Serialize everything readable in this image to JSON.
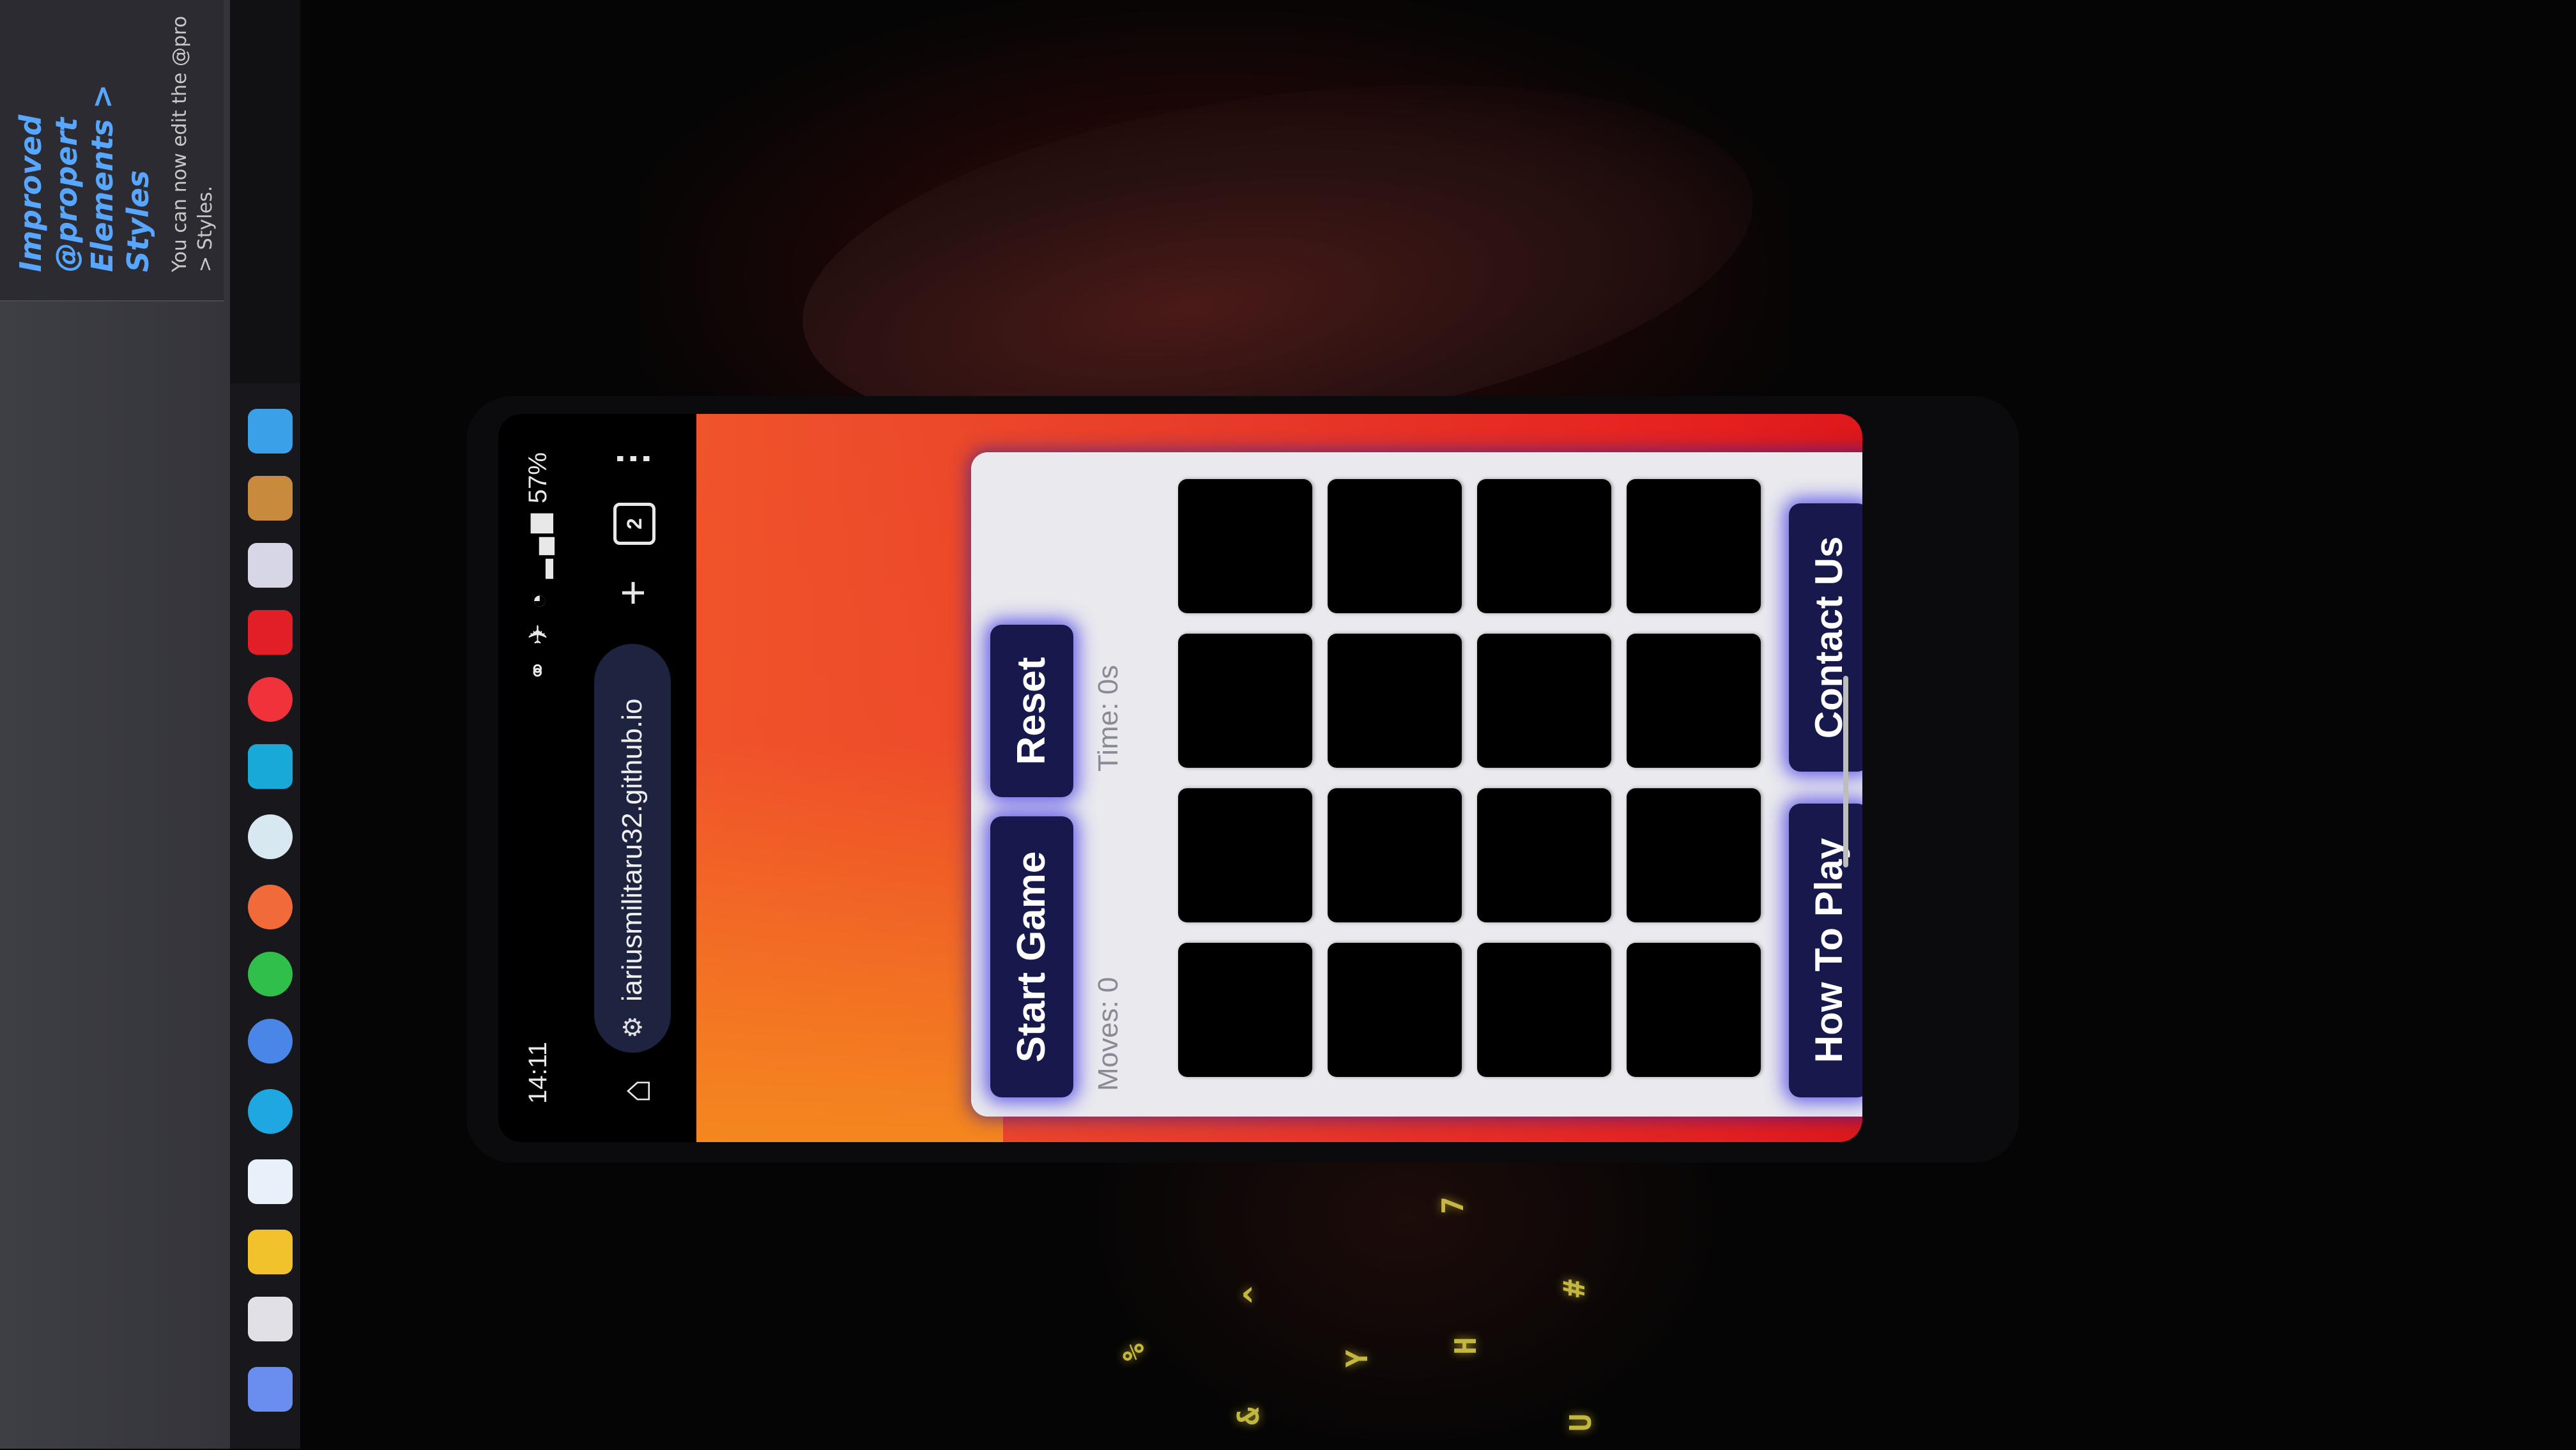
{
  "monitor": {
    "note_title": "Improved @propert Elements > Styles",
    "note_body": "You can now edit the @pro > Styles."
  },
  "phone": {
    "status": {
      "time": "14:11",
      "battery": "57%"
    },
    "browser": {
      "url": "iariusmilitaru32.github.io",
      "tab_count": "2"
    },
    "game": {
      "start_label": "Start Game",
      "reset_label": "Reset",
      "moves_text": "Moves: 0",
      "time_text": "Time: 0s",
      "how_to_play_label": "How To Play",
      "contact_label": "Contact Us",
      "grid_rows": 4,
      "grid_cols": 4
    }
  },
  "colors": {
    "button_bg": "#17194c",
    "button_glow": "#3c32e6",
    "card_bg": "#e9e9ee",
    "gradient_top": "#f58a1e",
    "gradient_bottom": "#d30d14",
    "url_pill": "#1e2340"
  },
  "icons": [
    "home-icon",
    "site-settings-icon",
    "add-tab-icon",
    "tab-switcher-icon",
    "overflow-menu-icon",
    "wifi-icon",
    "signal-icon",
    "battery-icon"
  ]
}
